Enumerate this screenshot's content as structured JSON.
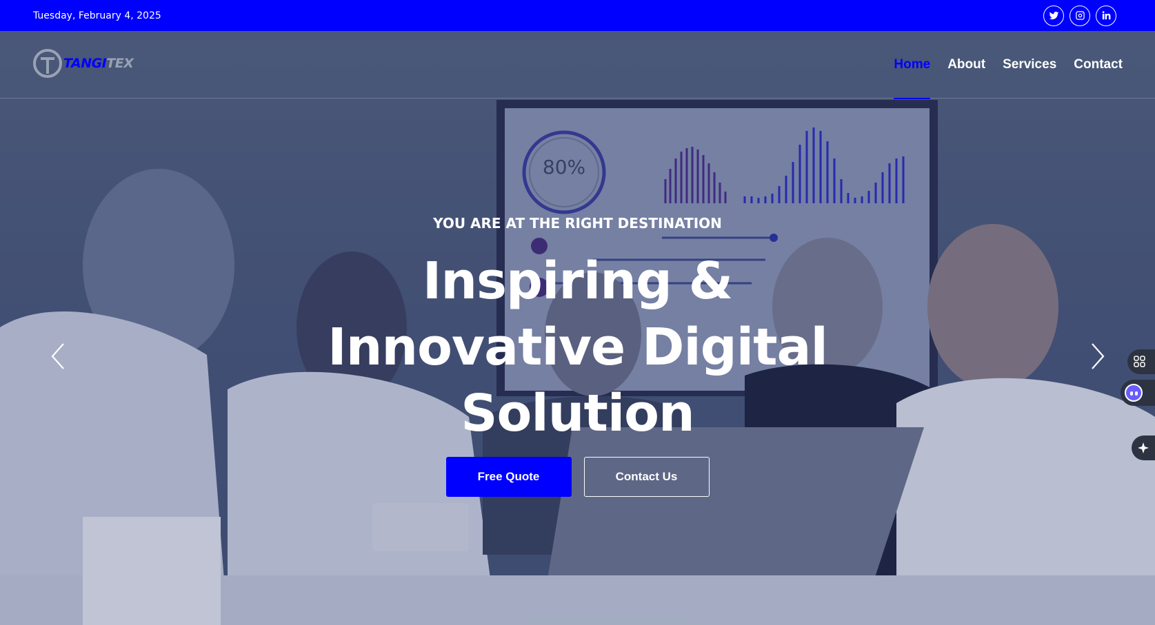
{
  "topbar": {
    "date": "Tuesday, February 4, 2025",
    "socials": [
      {
        "name": "twitter",
        "icon": "twitter-icon"
      },
      {
        "name": "instagram",
        "icon": "instagram-icon"
      },
      {
        "name": "linkedin",
        "icon": "linkedin-icon"
      }
    ]
  },
  "logo": {
    "part1": "TANGI",
    "part2": "TEX"
  },
  "nav": {
    "items": [
      {
        "label": "Home",
        "active": true
      },
      {
        "label": "About",
        "active": false
      },
      {
        "label": "Services",
        "active": false
      },
      {
        "label": "Contact",
        "active": false
      }
    ]
  },
  "hero": {
    "eyebrow": "YOU ARE AT THE RIGHT DESTINATION",
    "headline_line1": "Inspiring &",
    "headline_line2": "Innovative Digital",
    "headline_line3": "Solution",
    "buttons": {
      "primary": "Free Quote",
      "secondary": "Contact Us"
    },
    "screen_percent": "80%"
  },
  "colors": {
    "accent": "#0000ff",
    "topbar": "#0000ff",
    "overlay": "#4a5a78"
  }
}
